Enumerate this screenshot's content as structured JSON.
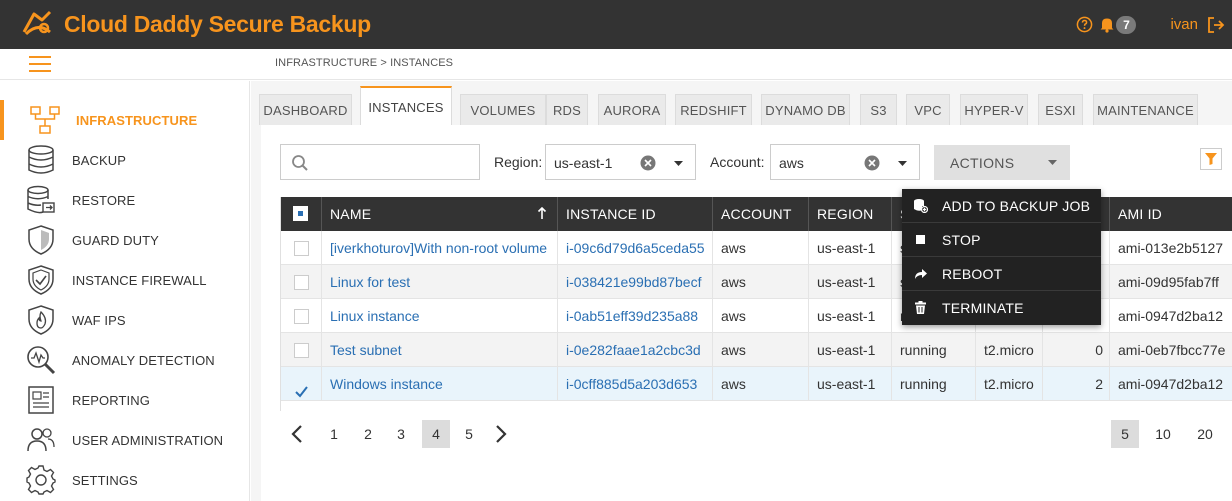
{
  "app": {
    "title": "Cloud Daddy Secure Backup",
    "user": "ivan",
    "notification_count": "7",
    "brand_color": "#f7941d"
  },
  "breadcrumb": "INFRASTRUCTURE > INSTANCES",
  "sidebar": {
    "items": [
      {
        "label": "INFRASTRUCTURE",
        "icon": "network-icon",
        "active": true
      },
      {
        "label": "BACKUP",
        "icon": "database-icon"
      },
      {
        "label": "RESTORE",
        "icon": "database-restore-icon"
      },
      {
        "label": "GUARD DUTY",
        "icon": "shield-icon"
      },
      {
        "label": "INSTANCE FIREWALL",
        "icon": "shield-check-icon"
      },
      {
        "label": "WAF IPS",
        "icon": "shield-fire-icon"
      },
      {
        "label": "ANOMALY DETECTION",
        "icon": "magnifier-chart-icon"
      },
      {
        "label": "REPORTING",
        "icon": "report-icon"
      },
      {
        "label": "USER ADMINISTRATION",
        "icon": "users-icon"
      },
      {
        "label": "SETTINGS",
        "icon": "gear-icon"
      }
    ]
  },
  "tabs": [
    "DASHBOARD",
    "INSTANCES",
    "VOLUMES",
    "RDS",
    "AURORA",
    "REDSHIFT",
    "DYNAMO DB",
    "S3",
    "VPC",
    "HYPER-V",
    "ESXI",
    "MAINTENANCE"
  ],
  "active_tab": "INSTANCES",
  "filters": {
    "search_placeholder": "",
    "region_label": "Region:",
    "region_value": "us-east-1",
    "account_label": "Account:",
    "account_value": "aws",
    "actions_label": "ACTIONS"
  },
  "table": {
    "columns": [
      "NAME",
      "INSTANCE ID",
      "ACCOUNT",
      "REGION",
      "S",
      "",
      "",
      "AMI ID"
    ],
    "rows": [
      {
        "name": "[iverkhoturov]With non-root volume",
        "instance_id": "i-09c6d79d6a5ceda55",
        "account": "aws",
        "region": "us-east-1",
        "state": "s",
        "type": "",
        "count": "",
        "ami": "ami-013e2b5127",
        "checked": false
      },
      {
        "name": "Linux for test",
        "instance_id": "i-038421e99bd87becf",
        "account": "aws",
        "region": "us-east-1",
        "state": "s",
        "type": "",
        "count": "",
        "ami": "ami-09d95fab7ff",
        "checked": false
      },
      {
        "name": "Linux instance",
        "instance_id": "i-0ab51eff39d235a88",
        "account": "aws",
        "region": "us-east-1",
        "state": "r",
        "type": "",
        "count": "",
        "ami": "ami-0947d2ba12",
        "checked": false
      },
      {
        "name": "Test subnet",
        "instance_id": "i-0e282faae1a2cbc3d",
        "account": "aws",
        "region": "us-east-1",
        "state": "running",
        "type": "t2.micro",
        "count": "0",
        "ami": "ami-0eb7fbcc77e",
        "checked": false
      },
      {
        "name": "Windows instance",
        "instance_id": "i-0cff885d5a203d653",
        "account": "aws",
        "region": "us-east-1",
        "state": "running",
        "type": "t2.micro",
        "count": "2",
        "ami": "ami-0947d2ba12",
        "checked": true
      }
    ]
  },
  "actions_menu": {
    "items": [
      {
        "label": "ADD TO BACKUP JOB",
        "icon": "database-add-icon"
      },
      {
        "label": "STOP",
        "icon": "stop-icon"
      },
      {
        "label": "REBOOT",
        "icon": "redo-arrow-icon"
      },
      {
        "label": "TERMINATE",
        "icon": "trash-icon"
      }
    ]
  },
  "pagination": {
    "pages": [
      "1",
      "2",
      "3",
      "4",
      "5"
    ],
    "current": "4",
    "page_sizes": [
      "5",
      "10",
      "20"
    ],
    "current_size": "5"
  }
}
